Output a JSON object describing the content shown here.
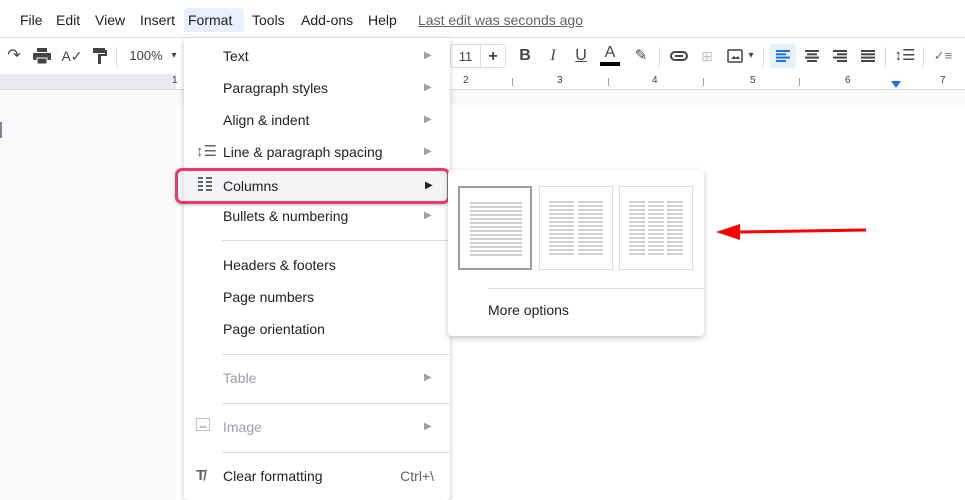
{
  "menubar": {
    "items": [
      "File",
      "Edit",
      "View",
      "Insert",
      "Format",
      "Tools",
      "Add-ons",
      "Help"
    ],
    "active": "Format",
    "last_edit": "Last edit was seconds ago"
  },
  "toolbar": {
    "zoom": "100%",
    "font_size": "11",
    "font_size_plus": "+",
    "bold": "B",
    "italic": "I",
    "underline": "U",
    "text_color": "A",
    "text_color_value": "#000000"
  },
  "ruler": {
    "labels": [
      "1",
      "2",
      "3",
      "4",
      "5",
      "6",
      "7"
    ]
  },
  "format_menu": {
    "items": [
      {
        "label": "Text",
        "submenu": true
      },
      {
        "label": "Paragraph styles",
        "submenu": true
      },
      {
        "label": "Align & indent",
        "submenu": true
      },
      {
        "label": "Line & paragraph spacing",
        "submenu": true,
        "icon": "line-spacing-icon"
      },
      {
        "label": "Columns",
        "submenu": true,
        "icon": "columns-icon",
        "highlighted": true
      },
      {
        "label": "Bullets & numbering",
        "submenu": true
      },
      {
        "label": "Headers & footers"
      },
      {
        "label": "Page numbers"
      },
      {
        "label": "Page orientation"
      },
      {
        "label": "Table",
        "submenu": true,
        "disabled": true
      },
      {
        "label": "Image",
        "submenu": true,
        "disabled": true,
        "icon": "image-icon"
      },
      {
        "label": "Clear formatting",
        "shortcut": "Ctrl+\\",
        "icon": "clear-formatting-icon"
      }
    ],
    "arrow": "▶"
  },
  "columns_submenu": {
    "presets": [
      {
        "name": "one-column",
        "columns": 1,
        "selected": true
      },
      {
        "name": "two-columns",
        "columns": 2,
        "selected": false
      },
      {
        "name": "three-columns",
        "columns": 3,
        "selected": false
      }
    ],
    "more_options": "More options"
  },
  "annotation": {
    "arrow_color": "#ff0000",
    "highlight_color": "#f0366a"
  }
}
